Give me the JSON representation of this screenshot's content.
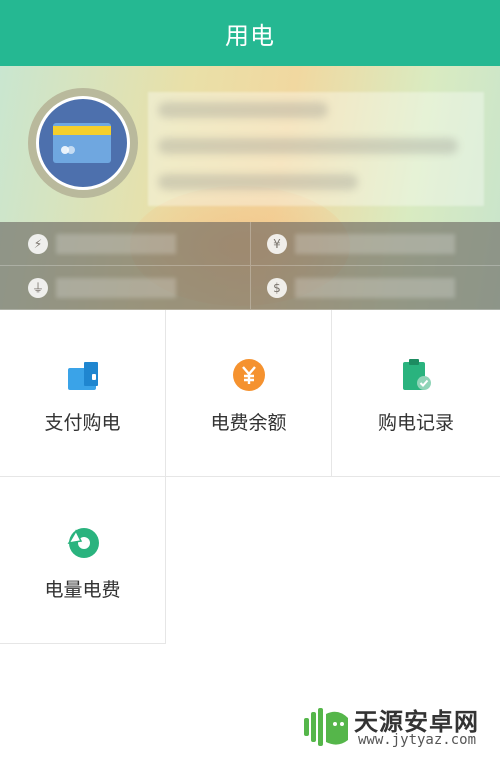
{
  "header": {
    "title": "用电"
  },
  "colors": {
    "accent": "#25b892",
    "orange": "#f5922f",
    "blue": "#3aa3e8",
    "teal": "#2ab37e"
  },
  "account": {
    "avatar_icon": "card-icon",
    "stats": [
      {
        "icon": "lightning-icon"
      },
      {
        "icon": "yuan-icon"
      },
      {
        "icon": "plug-icon"
      },
      {
        "icon": "money-bag-icon"
      }
    ]
  },
  "menu": [
    {
      "label": "支付购电",
      "icon": "wallet-icon"
    },
    {
      "label": "电费余额",
      "icon": "yuan-coin-icon"
    },
    {
      "label": "购电记录",
      "icon": "clipboard-check-icon"
    },
    {
      "label": "电量电费",
      "icon": "pie-chart-icon"
    }
  ],
  "watermark": {
    "name": "天源安卓网",
    "url": "www.jytyaz.com"
  }
}
